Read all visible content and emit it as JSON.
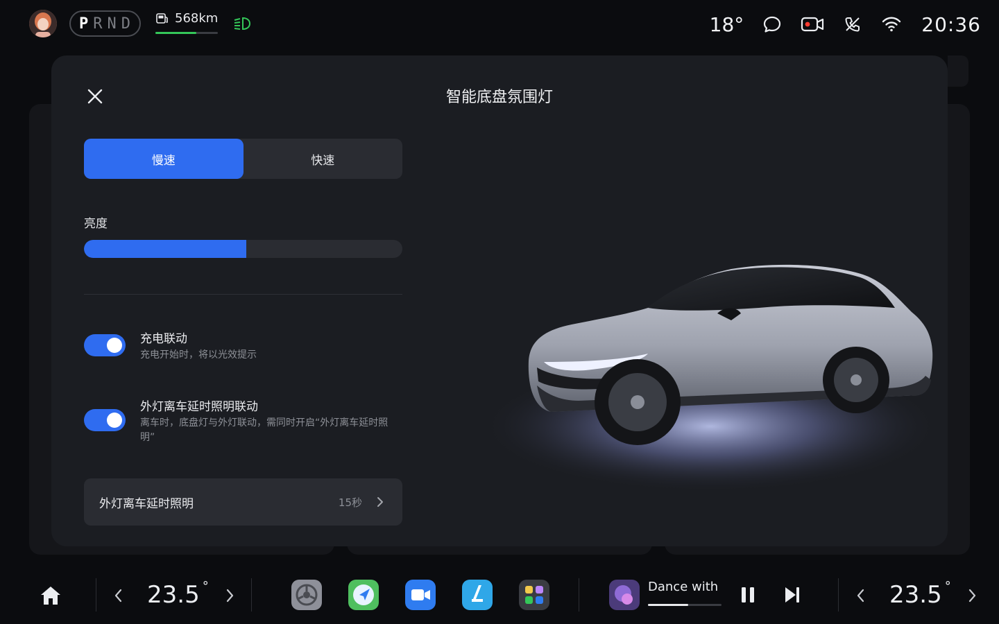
{
  "status": {
    "gear_letters": [
      "P",
      "R",
      "N",
      "D"
    ],
    "active_gear": "P",
    "range_text": "568km",
    "range_level": 0.66,
    "outside_temp": "18°",
    "time": "20:36"
  },
  "panel": {
    "title": "智能底盘氛围灯",
    "speed_modes": [
      "慢速",
      "快速"
    ],
    "active_speed_mode": "慢速",
    "brightness_label": "亮度",
    "brightness_level": 0.51,
    "options": [
      {
        "title": "充电联动",
        "description": "充电开始时，将以光效提示",
        "enabled": true
      },
      {
        "title": "外灯离车延时照明联动",
        "description": "离车时，底盘灯与外灯联动，需同时开启“外灯离车延时照明”",
        "enabled": true
      }
    ],
    "link_row": {
      "label": "外灯离车延时照明",
      "value": "15秒"
    }
  },
  "dock": {
    "driver_temp": "23.5",
    "passenger_temp": "23.5",
    "temp_unit": "°",
    "music_title": "Dance with",
    "music_progress": 0.55
  },
  "colors": {
    "accent": "#2f6cf0",
    "range_green": "#34c759"
  }
}
